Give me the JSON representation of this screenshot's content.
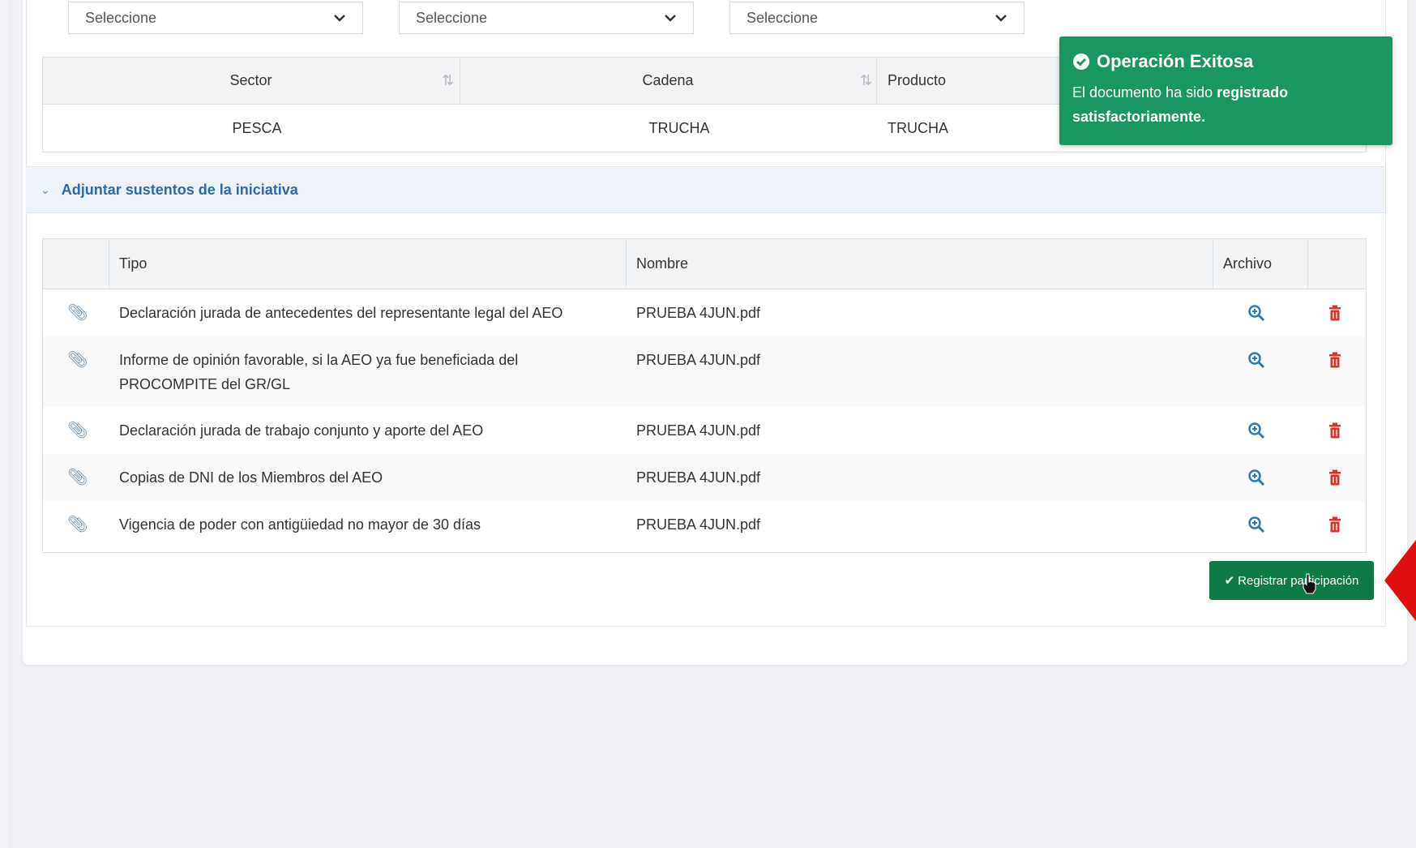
{
  "filters": {
    "select_1": "Seleccione",
    "select_2": "Seleccione",
    "select_3": "Seleccione"
  },
  "product_table": {
    "headers": {
      "sector": "Sector",
      "cadena": "Cadena",
      "producto": "Producto"
    },
    "row": {
      "sector": "PESCA",
      "cadena": "TRUCHA",
      "producto": "TRUCHA"
    }
  },
  "attachments": {
    "section_title": "Adjuntar sustentos de la iniciativa",
    "headers": {
      "tipo": "Tipo",
      "nombre": "Nombre",
      "archivo": "Archivo"
    },
    "rows": [
      {
        "tipo": "Declaración jurada de antecedentes del representante legal del AEO",
        "nombre": "PRUEBA 4JUN.pdf"
      },
      {
        "tipo": "Informe de opinión favorable, si la AEO ya fue beneficiada del PROCOMPITE del GR/GL",
        "nombre": "PRUEBA 4JUN.pdf"
      },
      {
        "tipo": "Declaración jurada de trabajo conjunto y aporte del AEO",
        "nombre": "PRUEBA 4JUN.pdf"
      },
      {
        "tipo": "Copias de DNI de los Miembros del AEO",
        "nombre": "PRUEBA 4JUN.pdf"
      },
      {
        "tipo": "Vigencia de poder con antigüiedad no mayor de 30 días",
        "nombre": "PRUEBA 4JUN.pdf"
      }
    ]
  },
  "toast": {
    "title": "Operación Exitosa",
    "message_prefix": "El documento ha sido ",
    "message_bold": "registrado satisfactoriamente.",
    "color": "#1a9760"
  },
  "register_button": {
    "label": "Registrar participación",
    "color": "#0f7a48"
  },
  "icons": {
    "attachment": "paperclip-icon",
    "view": "magnifier-icon",
    "delete": "trash-icon",
    "success": "check-circle-icon"
  }
}
